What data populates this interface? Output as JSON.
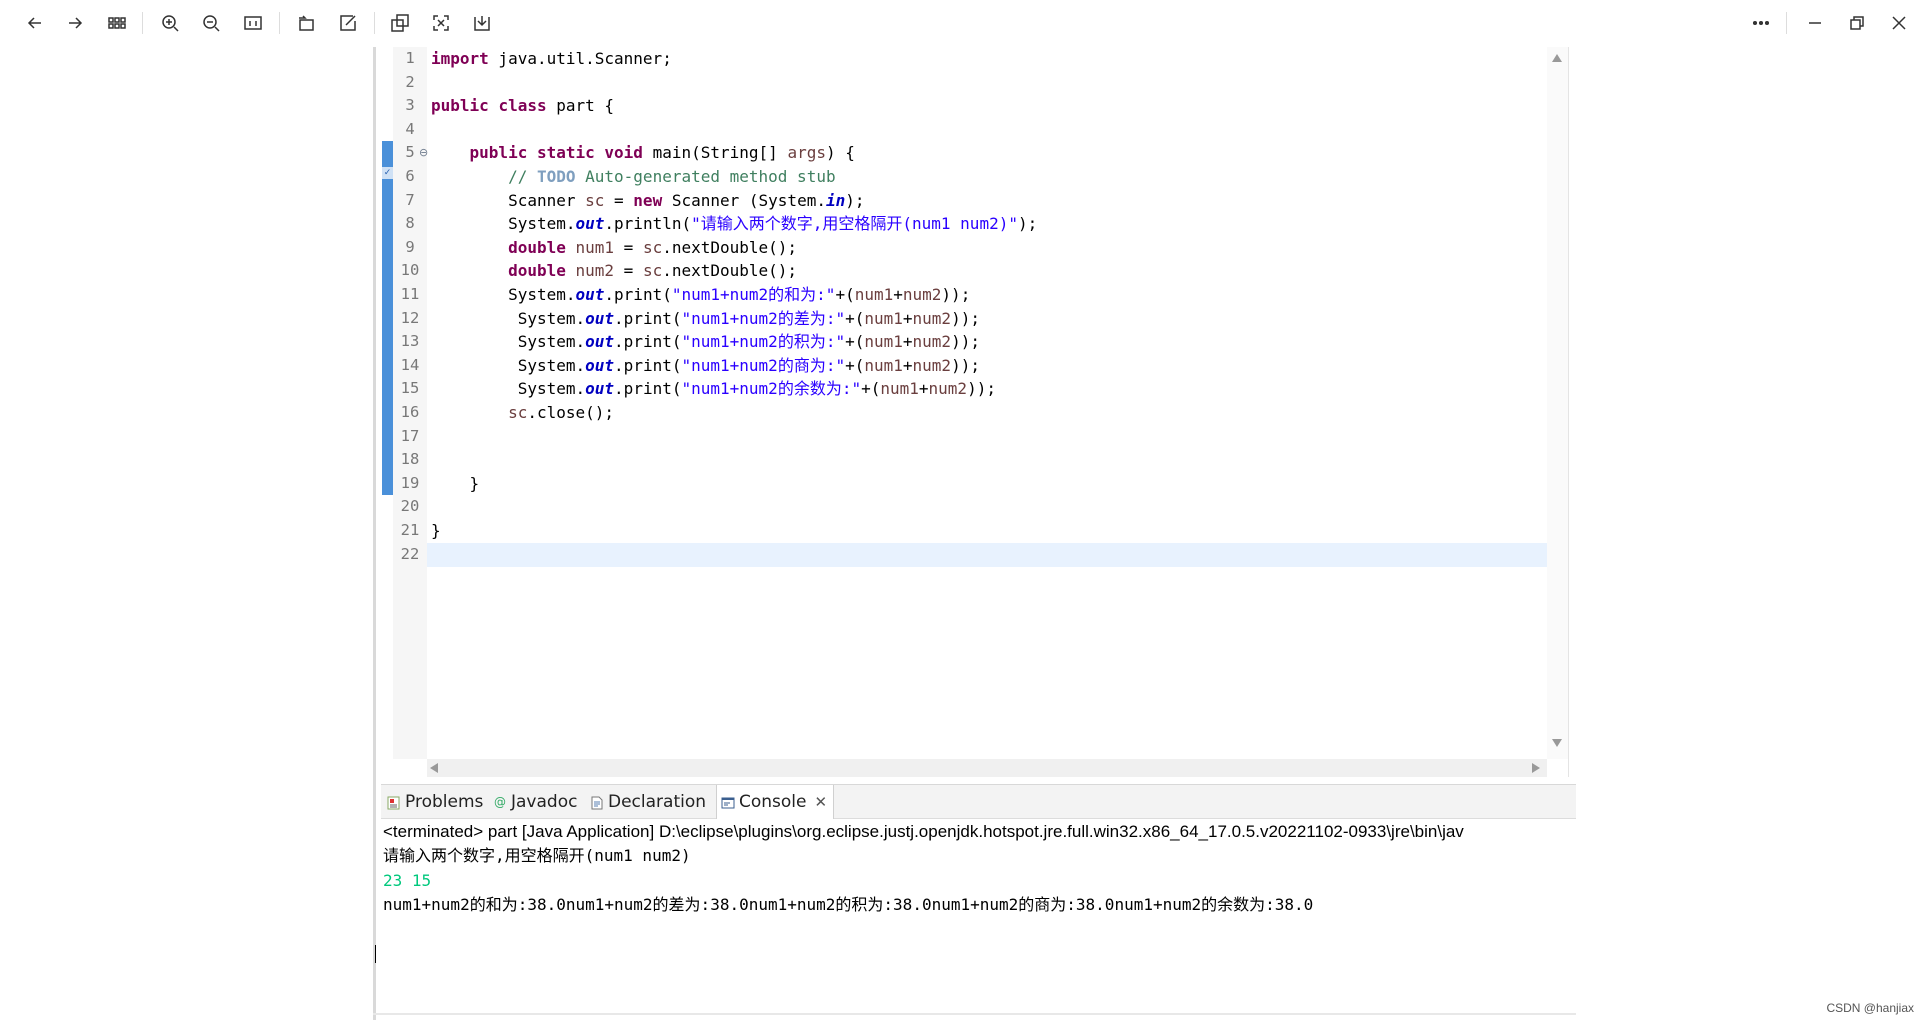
{
  "toolbar": {
    "buttons": [
      "back",
      "forward",
      "grid-view",
      "zoom-in",
      "zoom-out",
      "actual-size",
      "rotate",
      "edit",
      "copy",
      "fit-screen",
      "download"
    ],
    "window_buttons": [
      "more",
      "minimize",
      "restore",
      "close"
    ]
  },
  "editor": {
    "line_numbers": [
      "1",
      "2",
      "3",
      "4",
      "5",
      "6",
      "7",
      "8",
      "9",
      "10",
      "11",
      "12",
      "13",
      "14",
      "15",
      "16",
      "17",
      "18",
      "19",
      "20",
      "21",
      "22"
    ],
    "code": {
      "l1_kw": "import",
      "l1_rest": " java.util.Scanner;",
      "l3_kw1": "public",
      "l3_kw2": "class",
      "l3_rest": " part {",
      "l5_kw1": "public",
      "l5_kw2": "static",
      "l5_kw3": "void",
      "l5_a": " main(String[] ",
      "l5_var": "args",
      "l5_b": ") {",
      "l6_cmt1": "// ",
      "l6_todo": "TODO",
      "l6_cmt2": " Auto-generated method stub",
      "l7_a": "Scanner ",
      "l7_var": "sc",
      "l7_b": " = ",
      "l7_kw": "new",
      "l7_c": " Scanner (System.",
      "l7_fld": "in",
      "l7_d": ");",
      "l8_a": "System.",
      "l8_fld": "out",
      "l8_b": ".println(",
      "l8_str": "\"请输入两个数字,用空格隔开(num1 num2)\"",
      "l8_c": ");",
      "l9_kw": "double",
      "l9_var": "num1",
      "l9_b": " = ",
      "l9_var2": "sc",
      "l9_c": ".nextDouble();",
      "l10_kw": "double",
      "l10_var": "num2",
      "l10_b": " = ",
      "l10_var2": "sc",
      "l10_c": ".nextDouble();",
      "l11_a": "System.",
      "l11_fld": "out",
      "l11_b": ".print(",
      "l11_str": "\"num1+num2的和为:\"",
      "l11_c": "+(",
      "l11_v1": "num1",
      "l11_d": "+",
      "l11_v2": "num2",
      "l11_e": "));",
      "l12_a": "System.",
      "l12_fld": "out",
      "l12_b": ".print(",
      "l12_str": "\"num1+num2的差为:\"",
      "l12_c": "+(",
      "l12_v1": "num1",
      "l12_d": "+",
      "l12_v2": "num2",
      "l12_e": "));",
      "l13_a": "System.",
      "l13_fld": "out",
      "l13_b": ".print(",
      "l13_str": "\"num1+num2的积为:\"",
      "l13_c": "+(",
      "l13_v1": "num1",
      "l13_d": "+",
      "l13_v2": "num2",
      "l13_e": "));",
      "l14_a": "System.",
      "l14_fld": "out",
      "l14_b": ".print(",
      "l14_str": "\"num1+num2的商为:\"",
      "l14_c": "+(",
      "l14_v1": "num1",
      "l14_d": "+",
      "l14_v2": "num2",
      "l14_e": "));",
      "l15_a": "System.",
      "l15_fld": "out",
      "l15_b": ".print(",
      "l15_str": "\"num1+num2的余数为:\"",
      "l15_c": "+(",
      "l15_v1": "num1",
      "l15_d": "+",
      "l15_v2": "num2",
      "l15_e": "));",
      "l16_var": "sc",
      "l16_b": ".close();",
      "l19": "}",
      "l21": "}"
    }
  },
  "views": {
    "tabs": {
      "problems": "Problems",
      "javadoc": "Javadoc",
      "declaration": "Declaration",
      "console": "Console"
    },
    "console": {
      "terminated": "<terminated> part [Java Application] D:\\eclipse\\plugins\\org.eclipse.justj.openjdk.hotspot.jre.full.win32.x86_64_17.0.5.v20221102-0933\\jre\\bin\\jav",
      "prompt": "请输入两个数字,用空格隔开(num1 num2)",
      "input": "23 15",
      "output": "num1+num2的和为:38.0num1+num2的差为:38.0num1+num2的积为:38.0num1+num2的商为:38.0num1+num2的余数为:38.0"
    }
  },
  "watermark": "CSDN @hanjiax",
  "colors": {
    "keyword": "#7f0055",
    "string": "#2a00ff",
    "comment": "#3f7f5f",
    "field": "#0000c0",
    "console_input": "#00c87d",
    "change_bar": "#4a90d9"
  }
}
